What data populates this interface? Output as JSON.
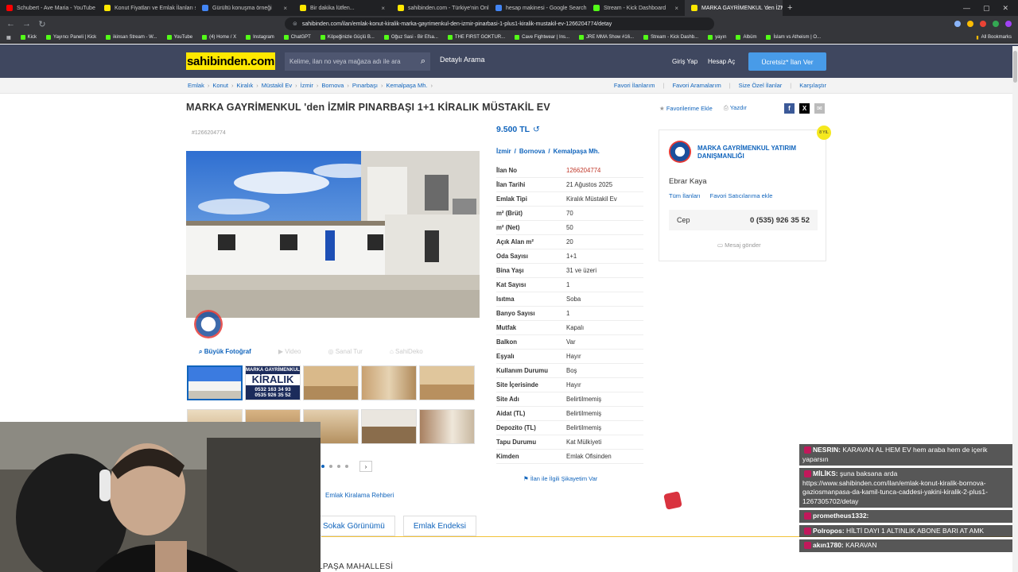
{
  "browser": {
    "tabs": [
      {
        "label": "Schubert - Ave Maria - YouTube",
        "color": "#ff0000"
      },
      {
        "label": "Konut Fiyatları ve Emlak İlanları sahib...",
        "color": "#ffe800"
      },
      {
        "label": "Gürültü konuşma örneği",
        "color": "#4285f4"
      },
      {
        "label": "Bir dakika lütfen...",
        "color": "#ffe800"
      },
      {
        "label": "sahibinden.com - Türkiye'nin Online...",
        "color": "#ffe800"
      },
      {
        "label": "hesap makinesi - Google Search",
        "color": "#4285f4"
      },
      {
        "label": "Stream - Kick Dashboard",
        "color": "#53fc18"
      },
      {
        "label": "MARKA GAYRİMENKUL 'den İZMİ...",
        "color": "#ffe800",
        "active": true
      }
    ],
    "url": "sahibinden.com/ilan/emlak-konut-kiralik-marka-gayrimenkul-den-izmir-pinarbasi-1-plus1-kiralik-mustakil-ev-1266204774/detay",
    "bookmarks": [
      "Kick",
      "Yayıncı Paneli | Kick",
      "ikinsan Stream - W...",
      "YouTube",
      "(4) Home / X",
      "Instagram",
      "ChatGPT",
      "Köpeğinizle Güçlü B...",
      "Oğuz Sasi - Bir Efsa...",
      "THE FIRST GOKTUR...",
      "Cave Fightwear | Ins...",
      "JRE MMA Show #16...",
      "Stream - Kick Dashb...",
      "yayın",
      "Albüm",
      "İslam vs Atheism | O..."
    ],
    "all_bookmarks": "All Bookmarks"
  },
  "header": {
    "logo": "sahibinden.com",
    "search_placeholder": "Kelime, ilan no veya mağaza adı ile ara",
    "detailed_search": "Detaylı Arama",
    "login": "Giriş Yap",
    "register": "Hesap Aç",
    "post_ad": "Ücretsiz* İlan Ver"
  },
  "breadcrumbs": [
    "Emlak",
    "Konut",
    "Kiralık",
    "Müstakil Ev",
    "İzmir",
    "Bornova",
    "Pınarbaşı",
    "Kemalpaşa Mh."
  ],
  "quick_links": [
    "Favori İlanlarım",
    "Favori Aramalarım",
    "Size Özel İlanlar",
    "Karşılaştır"
  ],
  "listing": {
    "title": "MARKA GAYRİMENKUL 'den İZMİR PINARBAŞI 1+1 KİRALIK MÜSTAKİL EV",
    "add_favorite": "Favorilerime Ekle",
    "print": "Yazdır",
    "id_small": "#1266204774",
    "price": "9.500 TL",
    "location": [
      "İzmir",
      "Bornova",
      "Kemalpaşa Mh."
    ],
    "media_tabs": [
      "Büyük Fotoğraf",
      "Video",
      "Sanal Tur",
      "SahiDeko"
    ],
    "thumb_banner_line1": "MARKA GAYRİMENKUL",
    "thumb_banner_line2": "KİRALIK",
    "thumb_banner_phone1": "0532 163 34 93",
    "thumb_banner_phone2": "0535 926 35 52",
    "details": [
      {
        "k": "İlan No",
        "v": "1266204774"
      },
      {
        "k": "İlan Tarihi",
        "v": "21 Ağustos 2025"
      },
      {
        "k": "Emlak Tipi",
        "v": "Kiralık Müstakil Ev"
      },
      {
        "k": "m² (Brüt)",
        "v": "70"
      },
      {
        "k": "m² (Net)",
        "v": "50"
      },
      {
        "k": "Açık Alan m²",
        "v": "20"
      },
      {
        "k": "Oda Sayısı",
        "v": "1+1"
      },
      {
        "k": "Bina Yaşı",
        "v": "31 ve üzeri"
      },
      {
        "k": "Kat Sayısı",
        "v": "1"
      },
      {
        "k": "Isıtma",
        "v": "Soba"
      },
      {
        "k": "Banyo Sayısı",
        "v": "1"
      },
      {
        "k": "Mutfak",
        "v": "Kapalı"
      },
      {
        "k": "Balkon",
        "v": "Var"
      },
      {
        "k": "Eşyalı",
        "v": "Hayır"
      },
      {
        "k": "Kullanım Durumu",
        "v": "Boş"
      },
      {
        "k": "Site İçerisinde",
        "v": "Hayır"
      },
      {
        "k": "Site Adı",
        "v": "Belirtilmemiş"
      },
      {
        "k": "Aidat (TL)",
        "v": "Belirtilmemiş"
      },
      {
        "k": "Depozito (TL)",
        "v": "Belirtilmemiş"
      },
      {
        "k": "Tapu Durumu",
        "v": "Kat Mülkiyeti"
      },
      {
        "k": "Kimden",
        "v": "Emlak Ofisinden"
      }
    ],
    "complaint": "İlan ile İlgili Şikayetim Var",
    "rent_guide": "Emlak Kiralama Rehberi",
    "street_view": "Sokak Görünümü",
    "index": "Emlak Endeksi",
    "neighborhood": "LPAŞA MAHALLESİ"
  },
  "seller": {
    "firm": "MARKA GAYRİMENKUL YATIRIM DANIŞMANLIĞI",
    "badge": "8 YIL",
    "agent": "Ebrar Kaya",
    "all_ads": "Tüm İlanları",
    "fav_seller": "Favori Satıcılarıma ekle",
    "phone_label": "Cep",
    "phone": "0 (535) 926 35 52",
    "message": "Mesaj gönder"
  },
  "chat": [
    {
      "user": "NESRIN:",
      "text": "KARAVAN AL HEM EV hem araba hem de içerik yaparsın"
    },
    {
      "user": "MİLİKS:",
      "text": "şuna baksana arda https://www.sahibinden.com/ilan/emlak-konut-kiralik-bornova-gaziosmanpasa-da-kamil-tunca-caddesi-yakini-kiralik-2-plus1-1267305702/detay"
    },
    {
      "user": "prometheus1332:",
      "text": ""
    },
    {
      "user": "Polropos:",
      "text": "HİLTİ DAYI 1 ALTINLIK ABONE BARI AT AMK"
    },
    {
      "user": "akın1780:",
      "text": "KARAVAN"
    }
  ]
}
